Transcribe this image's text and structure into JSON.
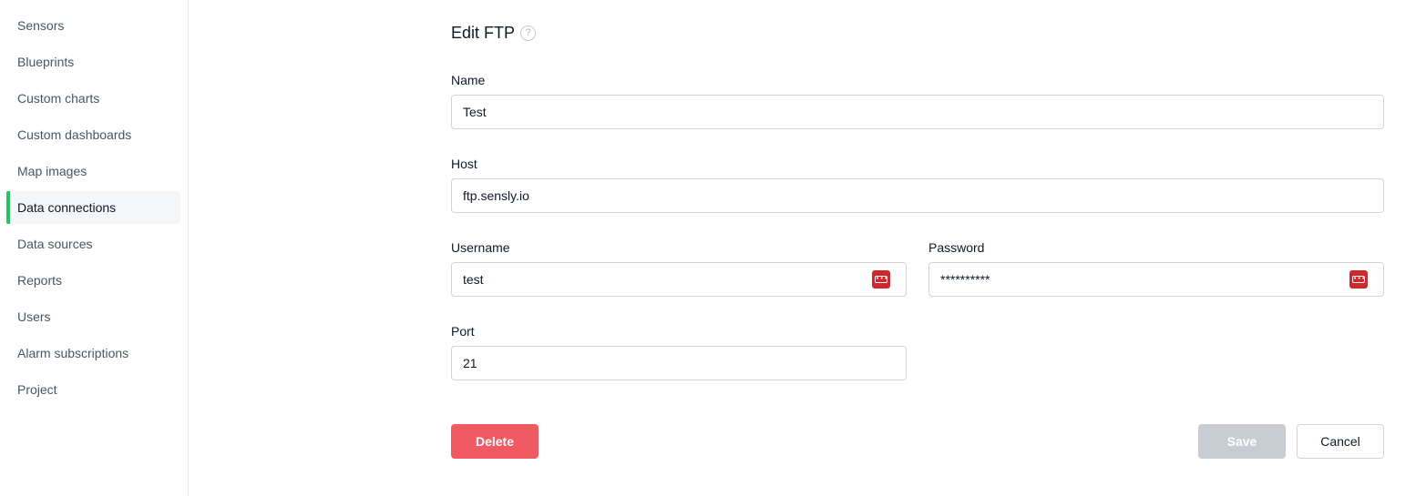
{
  "sidebar": {
    "items": [
      {
        "label": "Sensors"
      },
      {
        "label": "Blueprints"
      },
      {
        "label": "Custom charts"
      },
      {
        "label": "Custom dashboards"
      },
      {
        "label": "Map images"
      },
      {
        "label": "Data connections",
        "active": true
      },
      {
        "label": "Data sources"
      },
      {
        "label": "Reports"
      },
      {
        "label": "Users"
      },
      {
        "label": "Alarm subscriptions"
      },
      {
        "label": "Project"
      }
    ],
    "active_accent": "#22c55e"
  },
  "form": {
    "title": "Edit FTP",
    "help_icon_glyph": "?",
    "name": {
      "label": "Name",
      "value": "Test"
    },
    "host": {
      "label": "Host",
      "value": "ftp.sensly.io"
    },
    "username": {
      "label": "Username",
      "value": "test"
    },
    "password": {
      "label": "Password",
      "value": "**********"
    },
    "port": {
      "label": "Port",
      "value": "21"
    },
    "password_manager_icon": "password-manager-icon"
  },
  "actions": {
    "delete_label": "Delete",
    "save_label": "Save",
    "cancel_label": "Cancel",
    "delete_color": "#ef5a63",
    "save_disabled_color": "#c8ccd3"
  }
}
